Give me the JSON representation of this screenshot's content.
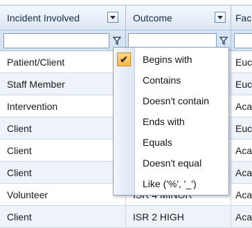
{
  "columns": {
    "incident": "Incident Involved",
    "outcome": "Outcome",
    "facility": "Fac"
  },
  "filter": {
    "incident_value": "",
    "outcome_value": ""
  },
  "rows": [
    {
      "incident": "Patient/Client",
      "outcome": "",
      "facility": "Euc"
    },
    {
      "incident": "Staff Member",
      "outcome": "",
      "facility": "Euc"
    },
    {
      "incident": "Intervention",
      "outcome": "",
      "facility": "Aca"
    },
    {
      "incident": "Client",
      "outcome": "",
      "facility": "Euc"
    },
    {
      "incident": "Client",
      "outcome": "",
      "facility": "Aca"
    },
    {
      "incident": "Client",
      "outcome": "",
      "facility": "Aca"
    },
    {
      "incident": "Volunteer",
      "outcome": "ISR 4 MINOR",
      "facility": "Aca"
    },
    {
      "incident": "Client",
      "outcome": "ISR 2 HIGH",
      "facility": "Aca"
    }
  ],
  "filter_menu": {
    "checked_index": 0,
    "items": [
      "Begins with",
      "Contains",
      "Doesn't contain",
      "Ends with",
      "Equals",
      "Doesn't equal",
      "Like ('%', '_')"
    ]
  },
  "icons": {
    "check": "check-icon",
    "filter": "filter-icon",
    "dropdown": "chevron-down-icon"
  },
  "colors": {
    "header_bg": "#dbe7f5",
    "filter_row_bg": "#d6e4f5",
    "alt_row_bg": "#eef3fa",
    "border": "#a5bfe0",
    "check_bg": "#f5b94a"
  }
}
